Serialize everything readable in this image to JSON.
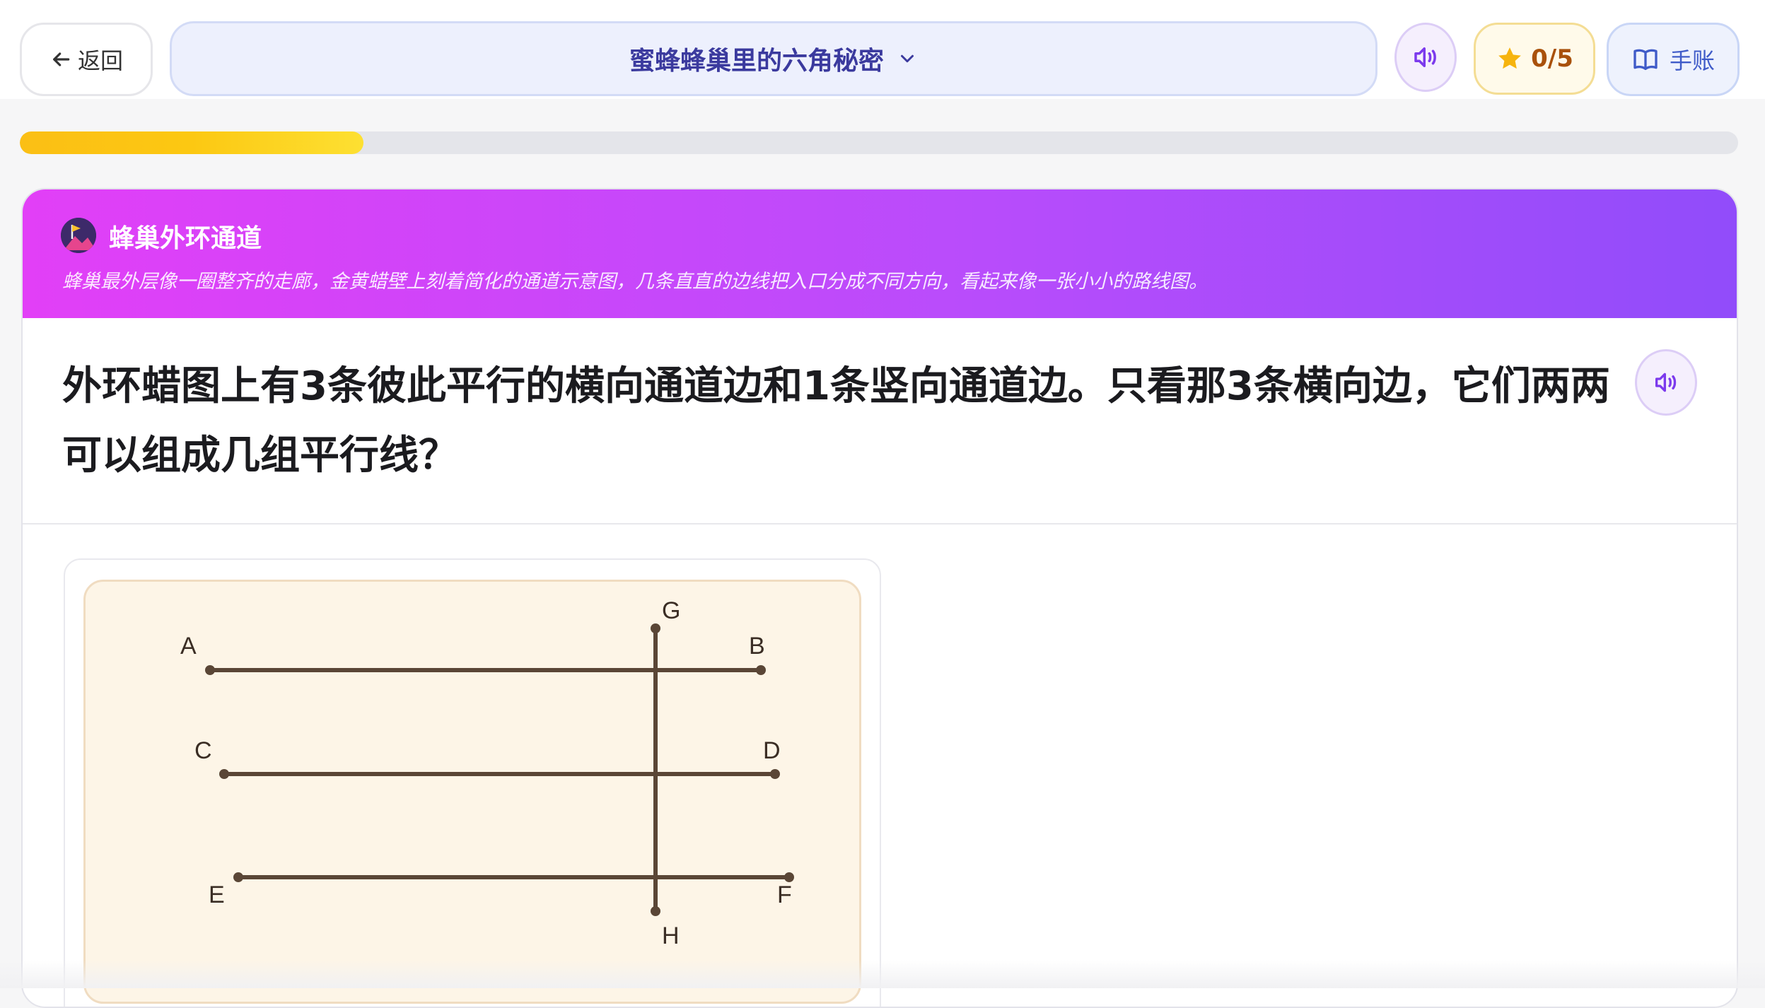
{
  "topbar": {
    "back_label": "返回",
    "lesson_title": "蜜蜂蜂巢里的六角秘密",
    "stars_score": "0/5",
    "journal_label": "手账",
    "progress": 0.2
  },
  "card": {
    "section_title": "蜂巢外环通道",
    "section_desc": "蜂巢最外层像一圈整齐的走廊，金黄蜡壁上刻着简化的通道示意图，几条直直的边线把入口分成不同方向，看起来像一张小小的路线图。",
    "question": "外环蜡图上有3条彼此平行的横向通道边和1条竖向通道边。只看那3条横向边，它们两两可以组成几组平行线？"
  },
  "figure": {
    "segments": [
      {
        "from": "A",
        "to": "B"
      },
      {
        "from": "C",
        "to": "D"
      },
      {
        "from": "E",
        "to": "F"
      },
      {
        "from": "G",
        "to": "H"
      }
    ],
    "labels": {
      "A": "A",
      "B": "B",
      "C": "C",
      "D": "D",
      "E": "E",
      "F": "F",
      "G": "G",
      "H": "H"
    }
  },
  "colors": {
    "accent_purple": "#b94cfb",
    "header_gradient_start": "#e23ff7",
    "header_gradient_end": "#914cfa",
    "progress_yellow": "#fcc812",
    "line_brown": "#5a4636",
    "figure_bg": "#fdf5e7"
  }
}
